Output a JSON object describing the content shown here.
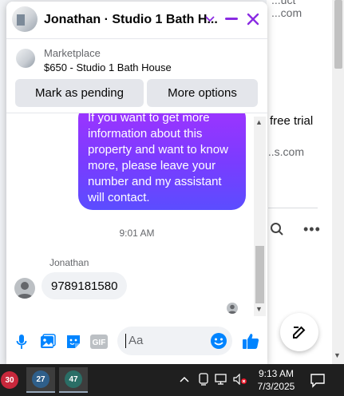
{
  "background": {
    "top_fragment": "...uct",
    "link1": "...com",
    "free_trial": "free trial",
    "link2": "...s.com",
    "more_label": "•••"
  },
  "chat": {
    "title": "Jonathan · Studio 1 Bath H...",
    "listing": {
      "kicker": "Marketplace",
      "name": "$650 - Studio 1 Bath House"
    },
    "buttons": {
      "pending": "Mark as pending",
      "more": "More options"
    },
    "outgoing_message": "If you want to get more information about this property and want to know more, please leave your number and my assistant will contact.",
    "timestamp": "9:01 AM",
    "sender": "Jonathan",
    "incoming_message": "9789181580",
    "composer": {
      "placeholder": "Aa",
      "gif_label": "GIF"
    },
    "colors": {
      "accent": "#0084ff",
      "bubble_top": "#a033ff",
      "bubble_bottom": "#5b4dff",
      "close": "#8a2be2"
    }
  },
  "taskbar": {
    "apps": [
      {
        "badge": "30",
        "color": "#c8283c",
        "icon": "app-badge-icon"
      },
      {
        "badge": "27",
        "color": "#2f5f8a",
        "icon": "app-badge-icon"
      },
      {
        "badge": "47",
        "color": "#2a6e66",
        "icon": "app-badge-icon"
      }
    ],
    "time": "9:13 AM",
    "date": "7/3/2025"
  }
}
